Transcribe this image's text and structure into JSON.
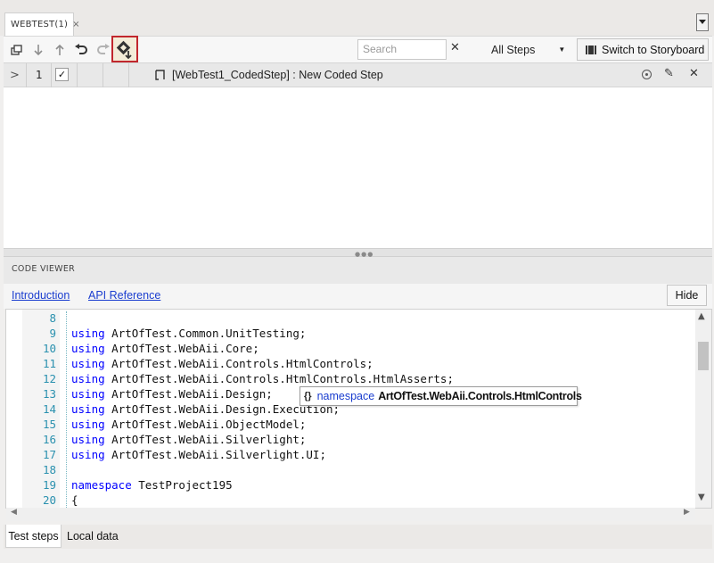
{
  "document_tab": {
    "title": "WEBTEST(1)",
    "close_glyph": "×"
  },
  "toolbar": {
    "icons": [
      "collapse-all-icon",
      "move-down-icon",
      "move-up-icon",
      "undo-icon",
      "redo-icon",
      "add-step-icon"
    ],
    "search_placeholder": "Search",
    "clear_glyph": "✕",
    "filter_value": "All Steps",
    "storyboard_label": "Switch to Storyboard"
  },
  "step": {
    "number": "1",
    "checked_glyph": "✓",
    "description": "[WebTest1_CodedStep] : New Coded Step"
  },
  "code_viewer": {
    "title": "CODE VIEWER",
    "links": {
      "introduction": "Introduction",
      "api_reference": "API Reference"
    },
    "hide_label": "Hide",
    "lines": [
      {
        "n": "8",
        "kw": "",
        "text": ""
      },
      {
        "n": "9",
        "kw": "using",
        "text": " ArtOfTest.Common.UnitTesting;"
      },
      {
        "n": "10",
        "kw": "using",
        "text": " ArtOfTest.WebAii.Core;"
      },
      {
        "n": "11",
        "kw": "using",
        "text": " ArtOfTest.WebAii.Controls.HtmlControls;"
      },
      {
        "n": "12",
        "kw": "using",
        "text": " ArtOfTest.WebAii.Controls.HtmlControls.HtmlAsserts;"
      },
      {
        "n": "13",
        "kw": "using",
        "text": " ArtOfTest.WebAii.Design;"
      },
      {
        "n": "14",
        "kw": "using",
        "text": " ArtOfTest.WebAii.Design.Execution;"
      },
      {
        "n": "15",
        "kw": "using",
        "text": " ArtOfTest.WebAii.ObjectModel;"
      },
      {
        "n": "16",
        "kw": "using",
        "text": " ArtOfTest.WebAii.Silverlight;"
      },
      {
        "n": "17",
        "kw": "using",
        "text": " ArtOfTest.WebAii.Silverlight.UI;"
      },
      {
        "n": "18",
        "kw": "",
        "text": ""
      },
      {
        "n": "19",
        "kw": "namespace",
        "text": " TestProject195"
      },
      {
        "n": "20",
        "kw": "",
        "text": "{"
      }
    ],
    "tooltip": {
      "brace": "{}",
      "keyword": "namespace",
      "name": "ArtOfTest.WebAii.Controls.HtmlControls"
    }
  },
  "bottom_tabs": {
    "test_steps": "Test steps",
    "local_data": "Local data"
  },
  "colors": {
    "highlight_border": "#c1272d",
    "keyword": "#0000ff",
    "line_number": "#2b91af",
    "link": "#1a3dcf"
  }
}
